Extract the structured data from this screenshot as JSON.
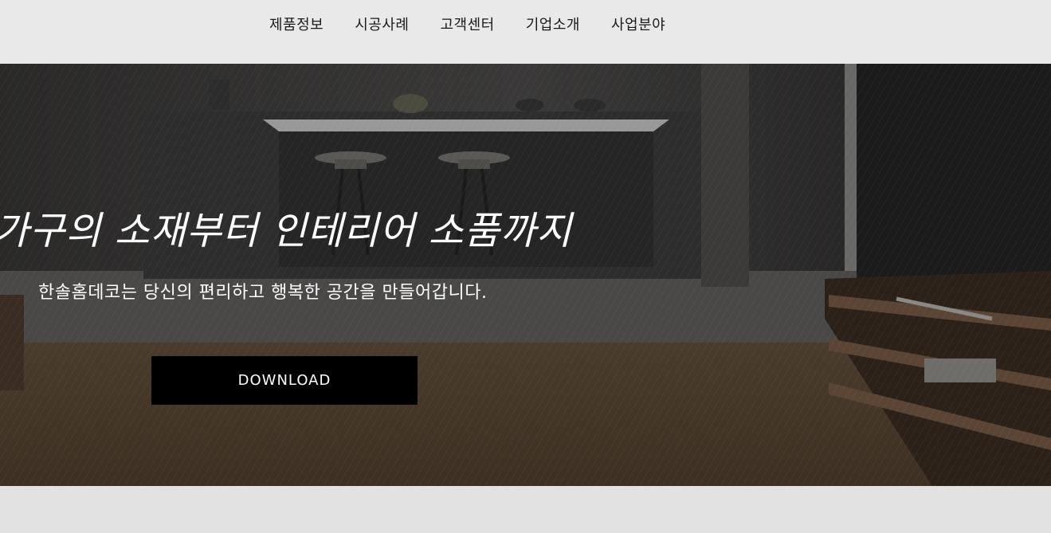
{
  "nav": {
    "items": [
      {
        "label": "제품정보"
      },
      {
        "label": "시공사례"
      },
      {
        "label": "고객센터"
      },
      {
        "label": "기업소개"
      },
      {
        "label": "사업분야"
      }
    ]
  },
  "hero": {
    "title": "가구의 소재부터 인테리어 소품까지",
    "subtitle": "한솔홈데코는 당신의 편리하고 행복한 공간을 만들어갑니다.",
    "button_label": "DOWNLOAD"
  },
  "colors": {
    "nav_background": "#e9e9e9",
    "button_background": "#000000",
    "hero_text": "#ffffff",
    "page_background": "#e2e2e2"
  }
}
